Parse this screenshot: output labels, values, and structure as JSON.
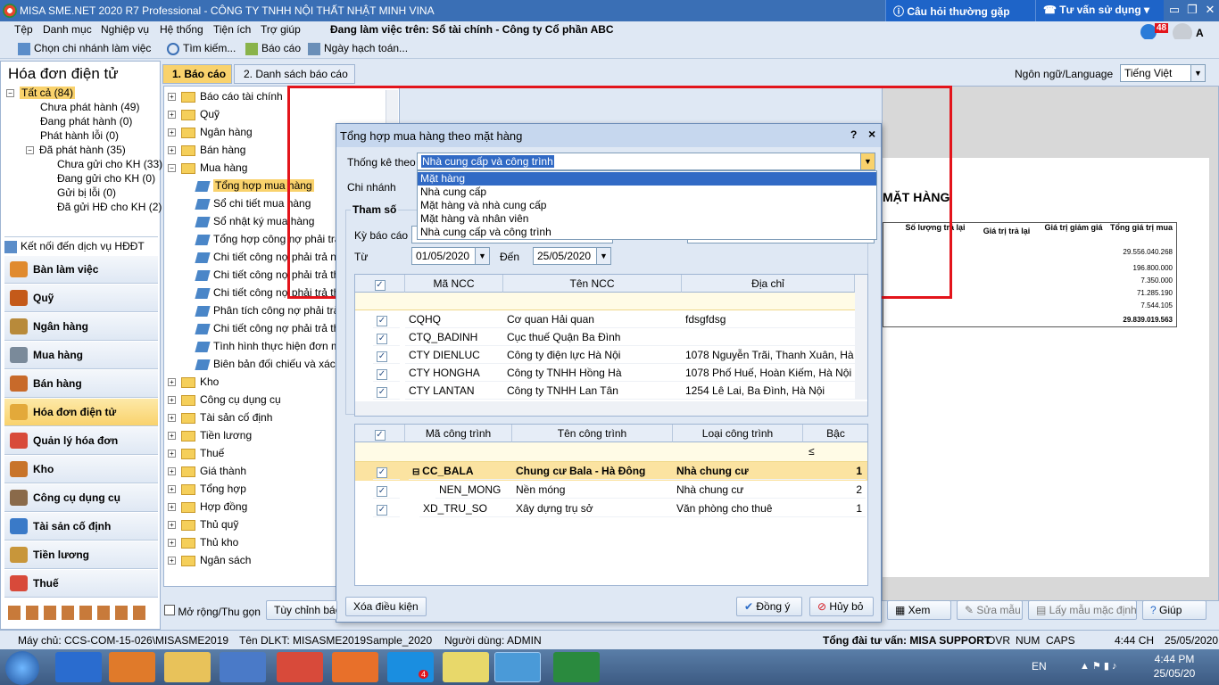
{
  "window": {
    "title": "MISA SME.NET 2020 R7 Professional - CÔNG TY TNHH NỘI THẤT NHẬT MINH VINA",
    "faq_tab": "Câu hỏi thường gặp",
    "advice_tab": "Tư vấn sử dụng",
    "user_label": "A"
  },
  "menu": {
    "items": [
      "Tệp",
      "Danh mục",
      "Nghiệp vụ",
      "Hệ thống",
      "Tiện ích",
      "Trợ giúp"
    ],
    "working_on": "Đang làm việc trên: Sổ tài chính - Công ty Cổ phần ABC",
    "notif_count": "48"
  },
  "toolbar": {
    "branch": "Chọn chi nhánh làm việc",
    "search": "Tìm kiếm...",
    "report": "Báo cáo",
    "posting_date": "Ngày hạch toán..."
  },
  "left": {
    "title": "Hóa đơn điện tử",
    "tree": [
      "Tất cả (84)",
      "Chưa phát hành (49)",
      "Đang phát hành (0)",
      "Phát hành lỗi (0)",
      "Đã phát hành (35)",
      "Chưa gửi cho KH (33)",
      "Đang gửi cho KH (0)",
      "Gửi bị lỗi (0)",
      "Đã gửi HĐ cho KH (2)"
    ],
    "connect": "Kết nối đến dịch vụ HĐĐT",
    "nav": [
      "Bàn làm việc",
      "Quỹ",
      "Ngân hàng",
      "Mua hàng",
      "Bán hàng",
      "Hóa đơn điện tử",
      "Quản lý hóa đơn",
      "Kho",
      "Công cụ dụng cụ",
      "Tài sản cố định",
      "Tiền lương",
      "Thuế"
    ]
  },
  "tabs": [
    "1. Báo cáo",
    "2. Danh sách báo cáo"
  ],
  "lang": {
    "label": "Ngôn ngữ/Language",
    "value": "Tiếng Việt"
  },
  "rtree": {
    "top": [
      "Báo cáo tài chính",
      "Quỹ",
      "Ngân hàng",
      "Bán hàng",
      "Mua hàng"
    ],
    "purchase": [
      "Tổng hợp mua hàng",
      "Sổ chi tiết mua hàng",
      "Sổ nhật ký mua hàng",
      "Tổng hợp công nợ phải trả n",
      "Chi tiết công nợ phải trả nhà",
      "Chi tiết công nợ phải trả the",
      "Chi tiết công nợ phải trả the",
      "Phân tích công nợ phải trả t",
      "Chi tiết công nợ phải trả the",
      "Tình hình thực hiện đơn mua",
      "Biên bản đối chiếu và xác n"
    ],
    "bottom": [
      "Kho",
      "Công cụ dụng cụ",
      "Tài sản cố định",
      "Tiền lương",
      "Thuế",
      "Giá thành",
      "Tổng hợp",
      "Hợp đồng",
      "Thủ quỹ",
      "Thủ kho",
      "Ngân sách"
    ]
  },
  "bottom_bar": {
    "expand": "Mở rộng/Thu gọn",
    "customize": "Tùy chỉnh báo",
    "view": "Xem",
    "edit_template": "Sửa mẫu",
    "default_template": "Lấy mẫu mặc định",
    "help": "Giúp"
  },
  "preview": {
    "heading": "MẶT HÀNG",
    "cols": [
      "Số lượng trả lại",
      "Giá trị trả lại",
      "Giá trị giảm giá",
      "Tổng giá trị mua"
    ],
    "totals": [
      "29.556.040.268",
      "196.800.000",
      "7.350.000",
      "71.285.190",
      "7.544.105",
      "29.839.019.563"
    ]
  },
  "dialog": {
    "title": "Tổng hợp mua hàng theo mặt hàng",
    "help": "?",
    "close": "×",
    "stat_label": "Thống kê theo",
    "stat_value": "Nhà cung cấp và công trình",
    "options": [
      "Mặt hàng",
      "Nhà cung cấp",
      "Mặt hàng và nhà cung cấp",
      "Mặt hàng và nhân viên",
      "Nhà cung cấp và công trình"
    ],
    "branch_label": "Chi nhánh",
    "params_label": "Tham số",
    "period_label": "Kỳ báo cáo",
    "from_label": "Từ",
    "from_value": "01/05/2020",
    "to_label": "Đến",
    "to_value": "25/05/2020",
    "supplier_cols": [
      "Mã NCC",
      "Tên NCC",
      "Địa chỉ"
    ],
    "suppliers": [
      [
        "CQHQ",
        "Cơ quan Hải quan",
        "fdsgfdsg"
      ],
      [
        "CTQ_BADINH",
        "Cục thuế Quận Ba Đình",
        ""
      ],
      [
        "CTY DIENLUC",
        "Công ty điện lực Hà Nội",
        "1078 Nguyễn Trãi, Thanh Xuân, Hà Nộ"
      ],
      [
        "CTY HONGHA",
        "Công ty TNHH Hồng Hà",
        "1078 Phố Huế, Hoàn Kiếm, Hà Nội"
      ],
      [
        "CTY LANTAN",
        "Công ty TNHH Lan Tân",
        "1254 Lê Lai, Ba Đình, Hà Nội"
      ]
    ],
    "project_cols": [
      "Mã công trình",
      "Tên công trình",
      "Loại công trình",
      "Bậc"
    ],
    "projects": [
      [
        "CC_BALA",
        "Chung cư Bala - Hà Đông",
        "Nhà chung cư",
        "1"
      ],
      [
        "NEN_MONG",
        "Nền móng",
        "Nhà chung cư",
        "2"
      ],
      [
        "XD_TRU_SO",
        "Xây dựng trụ sở",
        "Văn phòng cho thuê",
        "1"
      ]
    ],
    "filter_le": "≤",
    "clear": "Xóa điều kiện",
    "ok": "Đồng ý",
    "cancel": "Hủy bỏ"
  },
  "status": {
    "server": "Máy chủ: CCS-COM-15-026\\MISASME2019",
    "db": "Tên DLKT: MISASME2019Sample_2020",
    "user": "Người dùng: ADMIN",
    "hotline": "Tổng đài tư vấn: MISA SUPPORT",
    "ovr": "OVR",
    "num": "NUM",
    "caps": "CAPS",
    "time": "4:44 CH",
    "date": "25/05/2020"
  },
  "taskbar": {
    "lang": "EN",
    "time": "4:44 PM",
    "date": "25/05/20",
    "skype_badge": "4"
  },
  "colors": {
    "title_blue": "#3a6fb5",
    "highlight": "#f9d26c",
    "red_frame": "#e3141b"
  }
}
